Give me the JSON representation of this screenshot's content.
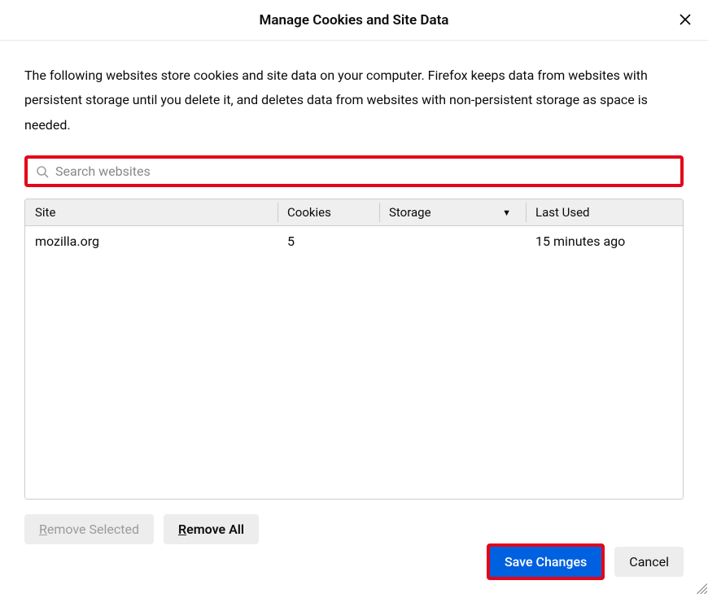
{
  "header": {
    "title": "Manage Cookies and Site Data"
  },
  "description": "The following websites store cookies and site data on your computer. Firefox keeps data from websites with persistent storage until you delete it, and deletes data from websites with non-persistent storage as space is needed.",
  "search": {
    "placeholder": "Search websites"
  },
  "table": {
    "columns": {
      "site": "Site",
      "cookies": "Cookies",
      "storage": "Storage",
      "last_used": "Last Used"
    },
    "sort_column": "storage",
    "sort_direction": "desc",
    "rows": [
      {
        "site": "mozilla.org",
        "cookies": "5",
        "storage": "",
        "last_used": "15 minutes ago"
      }
    ]
  },
  "buttons": {
    "remove_selected_letter": "R",
    "remove_selected_rest": "emove Selected",
    "remove_all_letter": "R",
    "remove_all_rest": "emove All",
    "save_changes": "Save Changes",
    "cancel": "Cancel"
  }
}
